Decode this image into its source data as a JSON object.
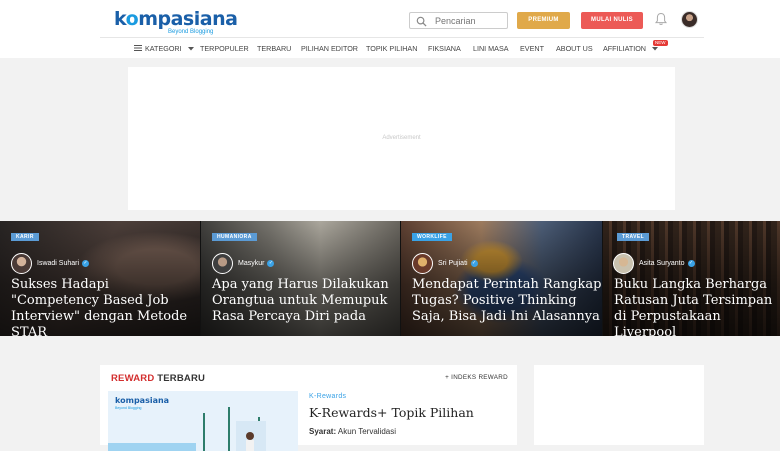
{
  "header": {
    "logo_brand_prefix": "k",
    "logo_brand_o": "o",
    "logo_brand_rest": "mpasiana",
    "logo_tagline": "Beyond Blogging",
    "search_placeholder": "Pencarian",
    "premium_label": "PREMIUM",
    "write_label": "MULAI NULIS",
    "colors": {
      "brand": "#1a5fa8",
      "premium": "#e0a94a",
      "write": "#ec5a56"
    }
  },
  "nav": {
    "items": [
      "KATEGORI",
      "TERPOPULER",
      "TERBARU",
      "PILIHAN EDITOR",
      "TOPIK PILIHAN",
      "FIKSIANA",
      "LINI MASA",
      "EVENT",
      "ABOUT US",
      "AFFILIATION"
    ],
    "new_badge": "NEW"
  },
  "ad": {
    "label": "Advertisement"
  },
  "featured": [
    {
      "category": "KARIR",
      "author": "Iswadi Suhari",
      "title": "Sukses Hadapi \"Competency Based Job Interview\" dengan Metode STAR",
      "label_color": "#5b9bd5"
    },
    {
      "category": "HUMANIORA",
      "author": "Masykur",
      "title": "Apa yang Harus Dilakukan Orangtua untuk Memupuk Rasa Percaya Diri pada",
      "label_color": "#5b9bd5"
    },
    {
      "category": "WORKLIFE",
      "author": "Sri Pujiati",
      "title": "Mendapat Perintah Rangkap Tugas? Positive Thinking Saja, Bisa Jadi Ini Alasannya",
      "label_color": "#3aa2e6"
    },
    {
      "category": "TRAVEL",
      "author": "Asita Suryanto",
      "title": "Buku Langka Berharga Ratusan Juta Tersimpan di Perpustakaan Liverpool",
      "label_color": "#5b9bd5"
    }
  ],
  "reward": {
    "head_red": "REWARD",
    "head_rest": " TERBARU",
    "index_link": "+ INDEKS REWARD",
    "thumb_logo": "kompasiana",
    "thumb_tagline": "Beyond Blogging",
    "category": "K-Rewards",
    "title": "K-Rewards+ Topik Pilihan",
    "syarat_label": "Syarat:",
    "syarat_value": " Akun Tervalidasi"
  }
}
